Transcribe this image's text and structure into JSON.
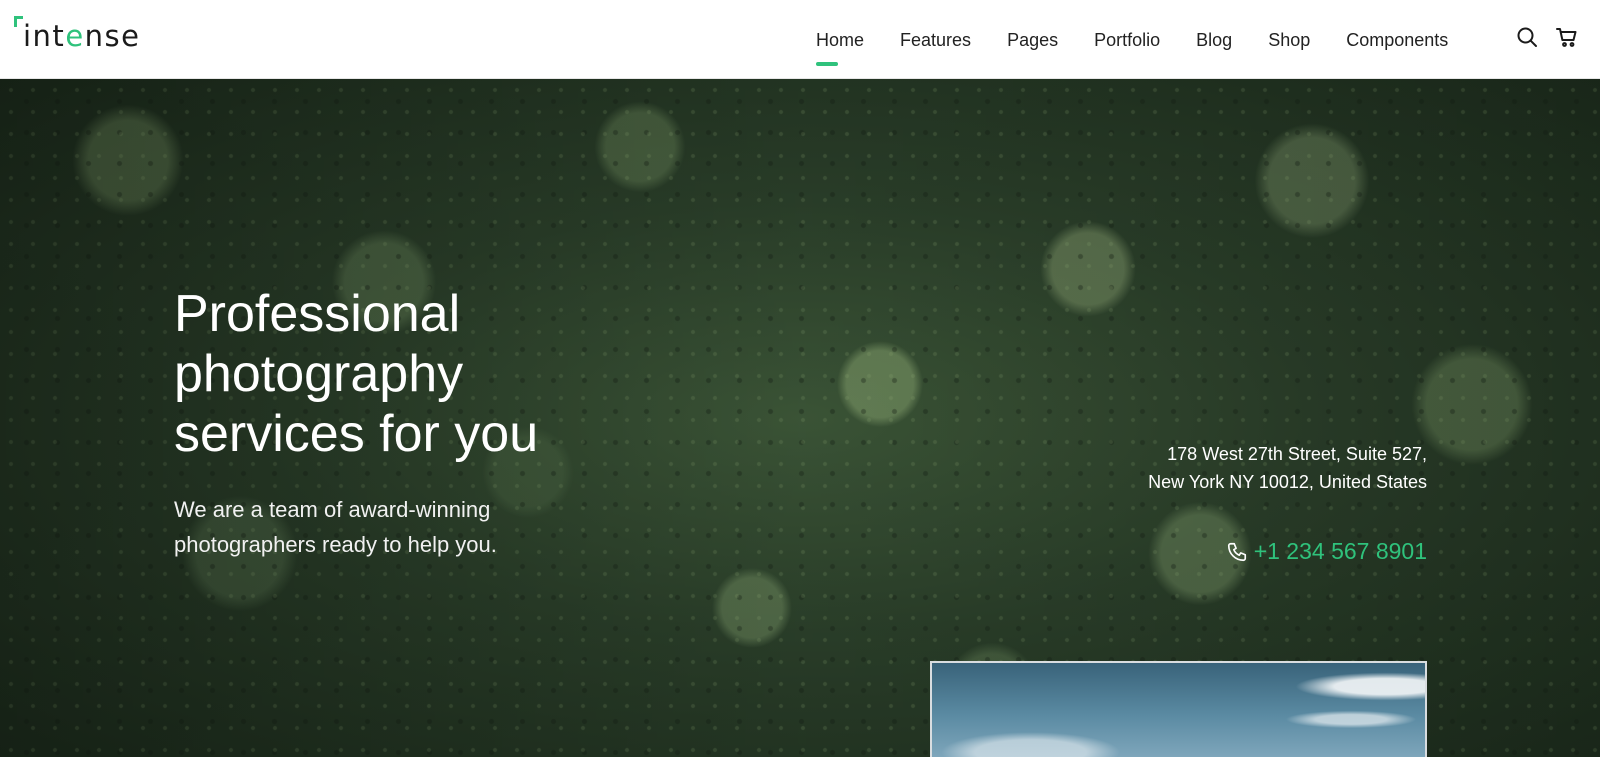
{
  "brand": {
    "logo_prefix": "int",
    "logo_accent": "e",
    "logo_suffix": "nse",
    "accent_color": "#2fc27c"
  },
  "nav": {
    "items": [
      {
        "label": "Home",
        "active": true
      },
      {
        "label": "Features",
        "active": false
      },
      {
        "label": "Pages",
        "active": false
      },
      {
        "label": "Portfolio",
        "active": false
      },
      {
        "label": "Blog",
        "active": false
      },
      {
        "label": "Shop",
        "active": false
      },
      {
        "label": "Components",
        "active": false
      }
    ],
    "icons": {
      "search": "search-icon",
      "cart": "cart-icon"
    }
  },
  "hero": {
    "title": "Professional\nphotography\nservices for you",
    "subtitle": "We are a team of award-winning\nphotographers ready to help you.",
    "address": "178 West 27th Street, Suite 527,\nNew York NY 10012, United States",
    "phone": "+1 234 567 8901",
    "phone_icon": "phone-icon"
  }
}
